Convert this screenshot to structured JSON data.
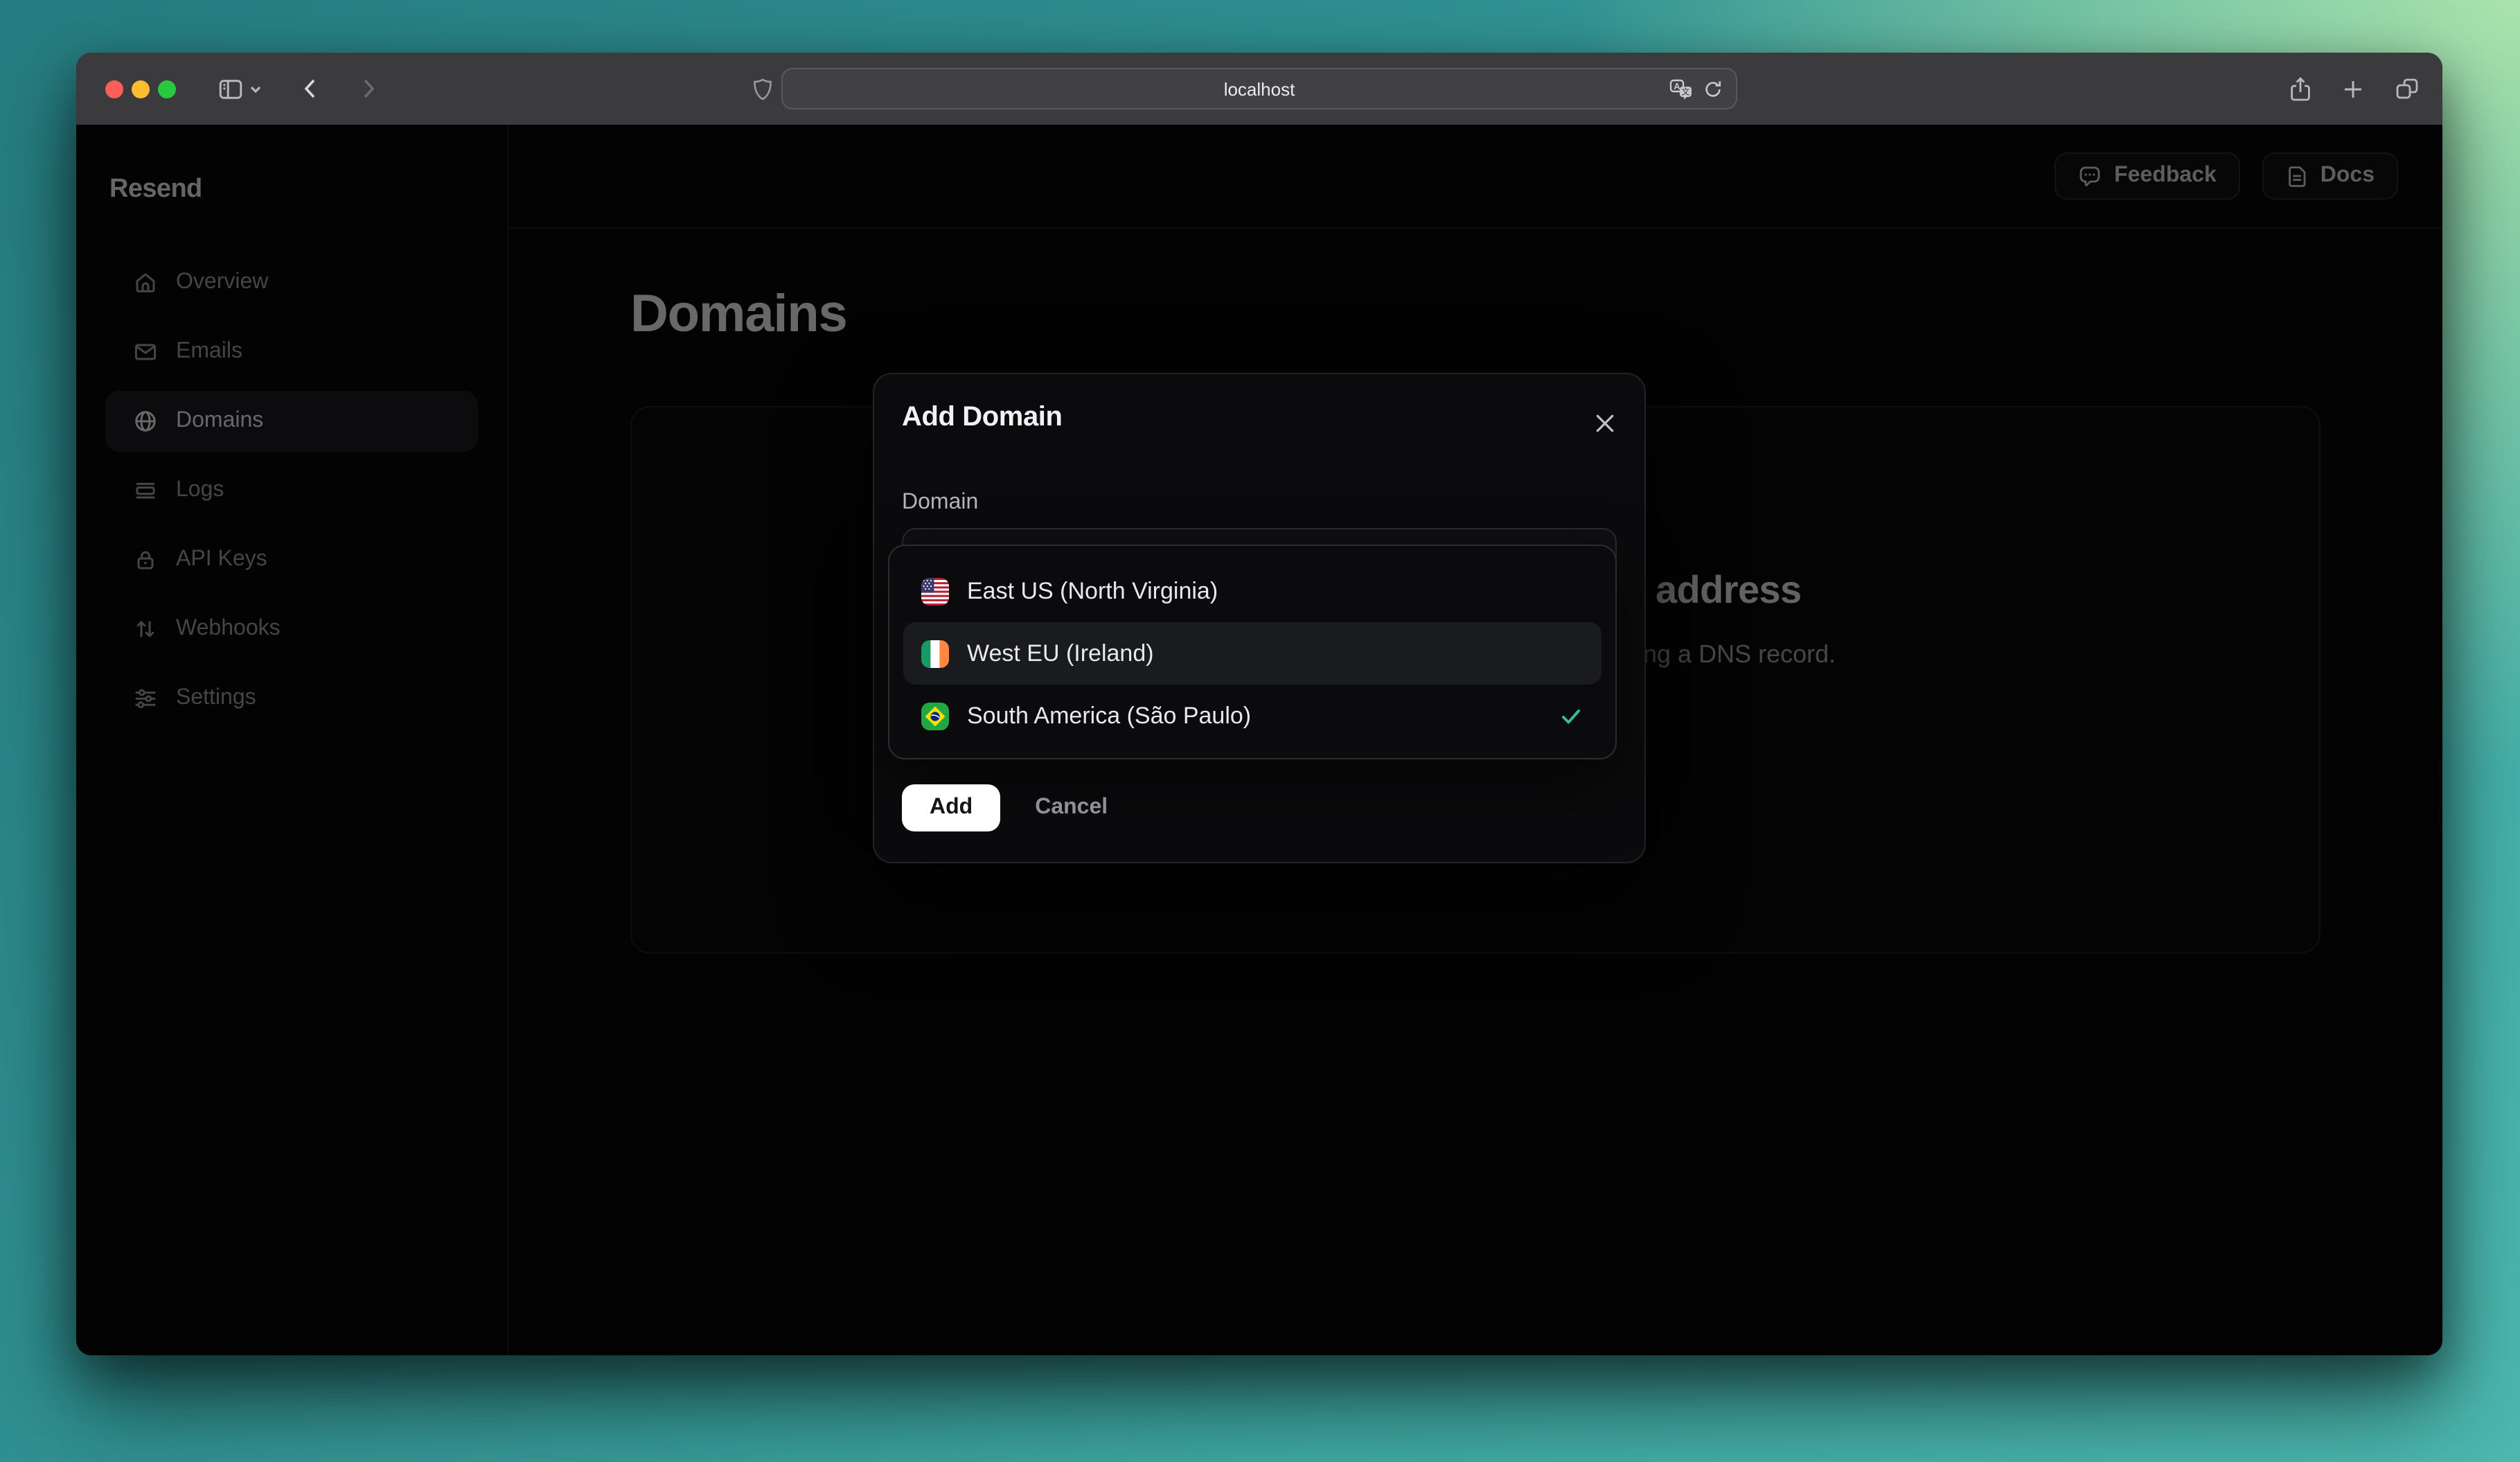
{
  "browser": {
    "url": "localhost",
    "traffic_lights": {
      "close": "#ff5f57",
      "minimize": "#febc2e",
      "zoom": "#28c840"
    }
  },
  "sidebar": {
    "logo": "Resend",
    "items": [
      {
        "label": "Overview",
        "icon": "home-icon",
        "active": false
      },
      {
        "label": "Emails",
        "icon": "mail-icon",
        "active": false
      },
      {
        "label": "Domains",
        "icon": "globe-icon",
        "active": true
      },
      {
        "label": "Logs",
        "icon": "logs-icon",
        "active": false
      },
      {
        "label": "API Keys",
        "icon": "lock-icon",
        "active": false
      },
      {
        "label": "Webhooks",
        "icon": "arrows-up-down-icon",
        "active": false
      },
      {
        "label": "Settings",
        "icon": "sliders-icon",
        "active": false
      }
    ]
  },
  "header": {
    "feedback": "Feedback",
    "docs": "Docs"
  },
  "page": {
    "title": "Domains",
    "card_heading_fragment": "address",
    "card_body_fragment": "ng a DNS record."
  },
  "modal": {
    "title": "Add Domain",
    "field_label": "Domain",
    "add_label": "Add",
    "cancel_label": "Cancel"
  },
  "region_dropdown": {
    "options": [
      {
        "label": "East US (North Virginia)",
        "flag": "us-flag",
        "highlighted": false,
        "selected": false
      },
      {
        "label": "West EU (Ireland)",
        "flag": "ireland-flag",
        "highlighted": true,
        "selected": false
      },
      {
        "label": "South America (São Paulo)",
        "flag": "brazil-flag",
        "highlighted": false,
        "selected": true
      }
    ],
    "check_color": "#3bb88f"
  }
}
